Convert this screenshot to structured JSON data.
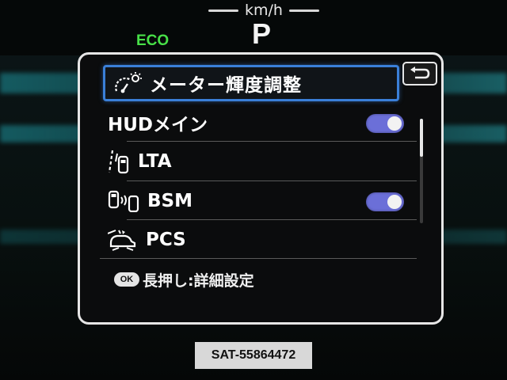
{
  "cluster": {
    "speed_unit": "km/h",
    "gear": "P",
    "drive_mode": "ECO"
  },
  "menu": {
    "title": "メーター輝度調整",
    "title_icon": "gauge-brightness-icon",
    "back_icon": "return-arrow-icon",
    "items": [
      {
        "label": "HUDメイン",
        "icon": "",
        "toggle": true,
        "toggle_on": true
      },
      {
        "label": "LTA",
        "icon": "lane-trace-assist-icon",
        "toggle": false
      },
      {
        "label": "BSM",
        "icon": "blind-spot-monitor-icon",
        "toggle": true,
        "toggle_on": true
      },
      {
        "label": "PCS",
        "icon": "pre-collision-system-icon",
        "toggle": false
      }
    ],
    "hint_badge": "OK",
    "hint_text": "長押し:詳細設定",
    "scroll_fraction": 0.0
  },
  "watermark": "SAT-55864472",
  "colors": {
    "eco_green": "#48e048",
    "selection_blue": "#3a7fd8",
    "toggle_on": "#6b6fd8"
  }
}
